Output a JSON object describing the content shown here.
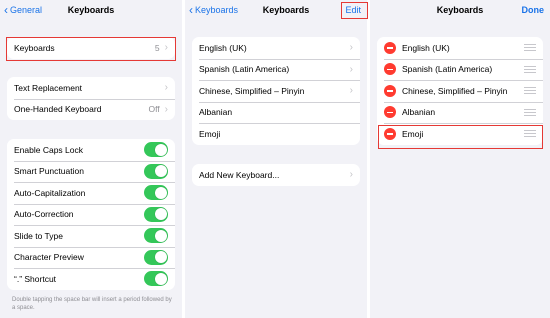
{
  "panel1": {
    "back_label": "General",
    "title": "Keyboards",
    "keyboards_row": {
      "label": "Keyboards",
      "value": "5"
    },
    "group2": [
      {
        "label": "Text Replacement",
        "value": ""
      },
      {
        "label": "One-Handed Keyboard",
        "value": "Off"
      }
    ],
    "toggles": [
      {
        "label": "Enable Caps Lock",
        "on": true
      },
      {
        "label": "Smart Punctuation",
        "on": true
      },
      {
        "label": "Auto-Capitalization",
        "on": true
      },
      {
        "label": "Auto-Correction",
        "on": true
      },
      {
        "label": "Slide to Type",
        "on": true
      },
      {
        "label": "Character Preview",
        "on": true
      },
      {
        "label": "“.” Shortcut",
        "on": true
      }
    ],
    "footnote": "Double tapping the space bar will insert a period followed by a space."
  },
  "panel2": {
    "back_label": "Keyboards",
    "title": "Keyboards",
    "edit_label": "Edit",
    "keyboards": [
      "English (UK)",
      "Spanish (Latin America)",
      "Chinese, Simplified – Pinyin",
      "Albanian",
      "Emoji"
    ],
    "add_label": "Add New Keyboard..."
  },
  "panel3": {
    "title": "Keyboards",
    "done_label": "Done",
    "keyboards": [
      "English (UK)",
      "Spanish (Latin America)",
      "Chinese, Simplified – Pinyin",
      "Albanian",
      "Emoji"
    ]
  },
  "colors": {
    "accent": "#1a73e8",
    "toggle_on": "#34c759",
    "delete": "#ff3b30",
    "highlight": "#e53935",
    "background": "#f2f2f7"
  }
}
